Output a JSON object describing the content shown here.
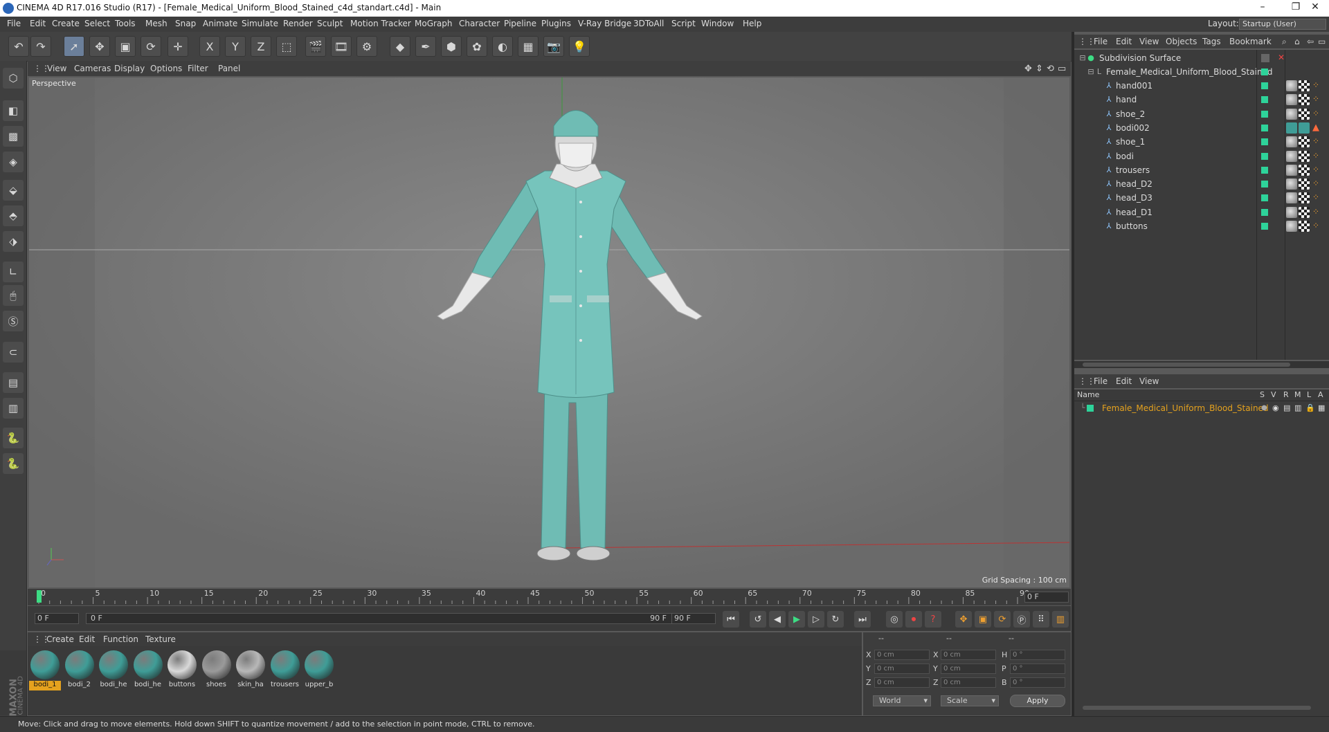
{
  "window": {
    "title": "CINEMA 4D R17.016 Studio (R17) - [Female_Medical_Uniform_Blood_Stained_c4d_standart.c4d] - Main"
  },
  "menubar": {
    "items": [
      "File",
      "Edit",
      "Create",
      "Select",
      "Tools",
      "Mesh",
      "Snap",
      "Animate",
      "Simulate",
      "Render",
      "Sculpt",
      "Motion Tracker",
      "MoGraph",
      "Character",
      "Pipeline",
      "Plugins",
      "V-Ray Bridge",
      "3DToAll",
      "Script",
      "Window",
      "Help"
    ],
    "layout_label": "Layout:",
    "layout_value": "Startup (User)"
  },
  "toolbar": {
    "axis_x": "X",
    "axis_y": "Y",
    "axis_z": "Z"
  },
  "viewport": {
    "menu": [
      "View",
      "Cameras",
      "Display",
      "Options",
      "Filter",
      "Panel"
    ],
    "camera_label": "Perspective",
    "grid_spacing": "Grid Spacing : 100 cm"
  },
  "timeline": {
    "ticks": [
      "0",
      "5",
      "10",
      "15",
      "20",
      "25",
      "30",
      "35",
      "40",
      "45",
      "50",
      "55",
      "60",
      "65",
      "70",
      "75",
      "80",
      "85",
      "90"
    ],
    "current_frame_right": "0 F",
    "start_field": "0 F",
    "range_start": "0 F",
    "range_end": "90 F",
    "end_field": "90 F"
  },
  "material_manager": {
    "menu": [
      "Create",
      "Edit",
      "Function",
      "Texture"
    ],
    "materials": [
      {
        "name": "bodi_1",
        "color": "#3f9d97",
        "active": true
      },
      {
        "name": "bodi_2",
        "color": "#3f9d97",
        "active": false
      },
      {
        "name": "bodi_he",
        "color": "#3f9d97",
        "active": false
      },
      {
        "name": "bodi_he",
        "color": "#3f9d97",
        "active": false
      },
      {
        "name": "buttons",
        "color": "#d9d9d9",
        "active": false
      },
      {
        "name": "shoes",
        "color": "#9a9a9a",
        "active": false
      },
      {
        "name": "skin_ha",
        "color": "#b8b8b8",
        "active": false
      },
      {
        "name": "trousers",
        "color": "#3f9d97",
        "active": false
      },
      {
        "name": "upper_b",
        "color": "#3f9d97",
        "active": false
      }
    ],
    "brand_line1": "MAXON",
    "brand_line2": "CINEMA 4D"
  },
  "coordinates": {
    "col1_header": "--",
    "col2_header": "--",
    "col3_header": "--",
    "rows": [
      {
        "l1": "X",
        "v1": "0 cm",
        "l2": "X",
        "v2": "0 cm",
        "l3": "H",
        "v3": "0 °"
      },
      {
        "l1": "Y",
        "v1": "0 cm",
        "l2": "Y",
        "v2": "0 cm",
        "l3": "P",
        "v3": "0 °"
      },
      {
        "l1": "Z",
        "v1": "0 cm",
        "l2": "Z",
        "v2": "0 cm",
        "l3": "B",
        "v3": "0 °"
      }
    ],
    "space_select": "World",
    "mode_select": "Scale",
    "apply_label": "Apply"
  },
  "object_manager": {
    "menu": [
      "File",
      "Edit",
      "View",
      "Objects",
      "Tags",
      "Bookmark"
    ],
    "root": "Subdivision Surface",
    "group": "Female_Medical_Uniform_Blood_Stained",
    "children": [
      "hand001",
      "hand",
      "shoe_2",
      "bodi002",
      "shoe_1",
      "bodi",
      "trousers",
      "head_D2",
      "head_D3",
      "head_D1",
      "buttons"
    ]
  },
  "layer_manager": {
    "menu": [
      "File",
      "Edit",
      "View"
    ],
    "columns": [
      "Name",
      "S",
      "V",
      "R",
      "M",
      "L",
      "A"
    ],
    "row_name": "Female_Medical_Uniform_Blood_Stained"
  },
  "status": {
    "text": "Move: Click and drag to move elements. Hold down SHIFT to quantize movement / add to the selection in point mode, CTRL to remove."
  },
  "colors": {
    "accent_orange": "#e5a21e",
    "active_green": "#2ed39a",
    "uniform_teal": "#6fbcb4"
  }
}
